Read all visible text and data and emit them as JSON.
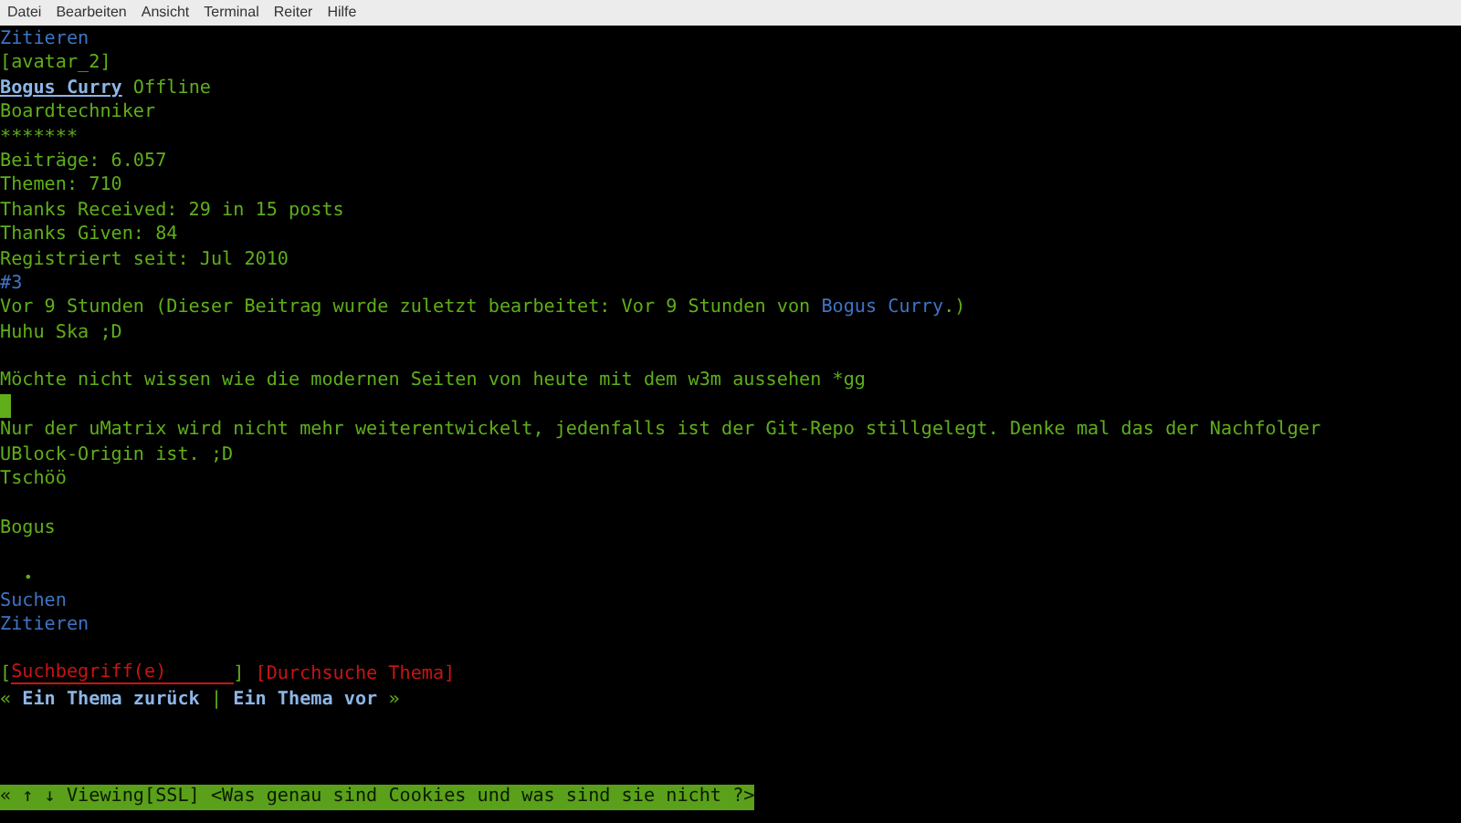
{
  "menu_bar": [
    "Datei",
    "Bearbeiten",
    "Ansicht",
    "Terminal",
    "Reiter",
    "Hilfe"
  ],
  "lines": [
    {
      "kind": "text",
      "segments": [
        {
          "kind": "link",
          "text": "Zitieren"
        }
      ]
    },
    {
      "kind": "text",
      "segments": [
        {
          "kind": "text",
          "text": "[avatar_2]"
        }
      ]
    },
    {
      "kind": "text",
      "segments": [
        {
          "kind": "strong_link",
          "text": "Bogus Curry",
          "focused": true
        },
        {
          "kind": "text",
          "text": " Offline"
        }
      ]
    },
    {
      "kind": "text",
      "segments": [
        {
          "kind": "text",
          "text": "Boardtechniker"
        }
      ]
    },
    {
      "kind": "text",
      "segments": [
        {
          "kind": "text",
          "text": "*******"
        }
      ]
    },
    {
      "kind": "text",
      "segments": [
        {
          "kind": "text",
          "text": "Beiträge: 6.057"
        }
      ]
    },
    {
      "kind": "text",
      "segments": [
        {
          "kind": "text",
          "text": "Themen: 710"
        }
      ]
    },
    {
      "kind": "text",
      "segments": [
        {
          "kind": "text",
          "text": "Thanks Received: 29 in 15 posts"
        }
      ]
    },
    {
      "kind": "text",
      "segments": [
        {
          "kind": "text",
          "text": "Thanks Given: 84"
        }
      ]
    },
    {
      "kind": "text",
      "segments": [
        {
          "kind": "text",
          "text": "Registriert seit: Jul 2010"
        }
      ]
    },
    {
      "kind": "text",
      "segments": [
        {
          "kind": "link",
          "text": "#3"
        }
      ]
    },
    {
      "kind": "text",
      "segments": [
        {
          "kind": "text",
          "text": "Vor 9 Stunden (Dieser Beitrag wurde zuletzt bearbeitet: Vor 9 Stunden von "
        },
        {
          "kind": "link",
          "text": "Bogus Curry"
        },
        {
          "kind": "text",
          "text": ".)"
        }
      ]
    },
    {
      "kind": "text",
      "segments": [
        {
          "kind": "text",
          "text": "Huhu Ska ;D"
        }
      ]
    },
    {
      "kind": "blank"
    },
    {
      "kind": "text",
      "segments": [
        {
          "kind": "text",
          "text": "Möchte nicht wissen wie die modernen Seiten von heute mit dem w3m aussehen *gg"
        }
      ]
    },
    {
      "kind": "cursor"
    },
    {
      "kind": "text",
      "segments": [
        {
          "kind": "text",
          "text": "Nur der uMatrix wird nicht mehr weiterentwickelt, jedenfalls ist der Git-Repo stillgelegt. Denke mal das der Nachfolger"
        }
      ]
    },
    {
      "kind": "text",
      "segments": [
        {
          "kind": "text",
          "text": "UBlock-Origin ist. ;D"
        }
      ]
    },
    {
      "kind": "text",
      "segments": [
        {
          "kind": "text",
          "text": "Tschöö"
        }
      ]
    },
    {
      "kind": "blank"
    },
    {
      "kind": "text",
      "segments": [
        {
          "kind": "text",
          "text": "Bogus"
        }
      ]
    },
    {
      "kind": "blank"
    },
    {
      "kind": "text",
      "segments": [
        {
          "kind": "bullet",
          "text": "•"
        }
      ]
    },
    {
      "kind": "text",
      "segments": [
        {
          "kind": "link",
          "text": "Suchen"
        }
      ]
    },
    {
      "kind": "text",
      "segments": [
        {
          "kind": "link",
          "text": "Zitieren"
        }
      ]
    },
    {
      "kind": "blank"
    },
    {
      "kind": "text",
      "segments": [
        {
          "kind": "text",
          "text": "["
        },
        {
          "kind": "input",
          "value": "Suchbegriff(e)"
        },
        {
          "kind": "text",
          "text": "]"
        },
        {
          "kind": "button",
          "text": "[Durchsuche Thema]"
        }
      ]
    },
    {
      "kind": "text",
      "segments": [
        {
          "kind": "text",
          "text": "« "
        },
        {
          "kind": "strong_link",
          "text": "Ein Thema zurück",
          "focused": false
        },
        {
          "kind": "text",
          "text": " | "
        },
        {
          "kind": "strong_link",
          "text": "Ein Thema vor",
          "focused": false
        },
        {
          "kind": "text",
          "text": " »"
        }
      ]
    },
    {
      "kind": "blank"
    },
    {
      "kind": "blank"
    },
    {
      "kind": "blank"
    }
  ],
  "status_bar": "« ↑ ↓ Viewing[SSL] <Was genau sind Cookies und was sind sie nicht ?>"
}
